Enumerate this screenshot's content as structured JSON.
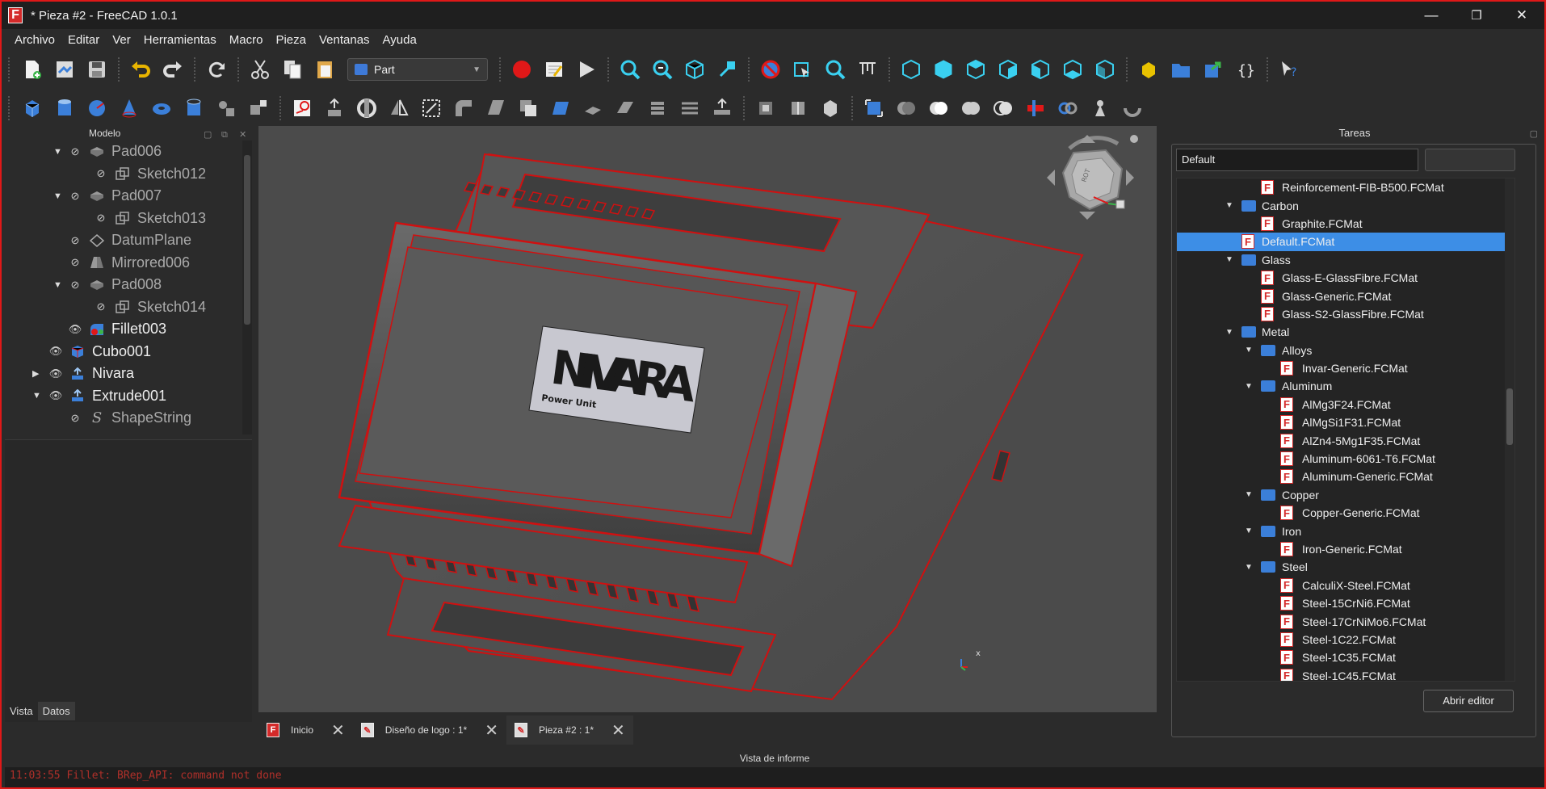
{
  "window": {
    "title": "* Pieza #2 - FreeCAD 1.0.1",
    "logo": "F",
    "controls": {
      "minimize": "—",
      "maximize": "❐",
      "close": "✕"
    }
  },
  "menubar": [
    "Archivo",
    "Editar",
    "Ver",
    "Herramientas",
    "Macro",
    "Pieza",
    "Ventanas",
    "Ayuda"
  ],
  "toolbar": {
    "workbench": "Part"
  },
  "model_panel": {
    "title": "Modelo",
    "items": [
      {
        "label": "Pad006"
      },
      {
        "label": "Sketch012"
      },
      {
        "label": "Pad007"
      },
      {
        "label": "Sketch013"
      },
      {
        "label": "DatumPlane"
      },
      {
        "label": "Mirrored006"
      },
      {
        "label": "Pad008"
      },
      {
        "label": "Sketch014"
      },
      {
        "label": "Fillet003"
      },
      {
        "label": "Cubo001"
      },
      {
        "label": "Nivara"
      },
      {
        "label": "Extrude001"
      },
      {
        "label": "ShapeString"
      }
    ],
    "tabs": [
      "Vista",
      "Datos"
    ]
  },
  "view3d": {
    "logo_text": "NIVARA",
    "logo_subtext": "Power Unit",
    "axis_label": "x"
  },
  "doc_tabs": [
    {
      "label": "Inicio"
    },
    {
      "label": "Diseño de logo : 1*"
    },
    {
      "label": "Pieza #2 : 1*"
    }
  ],
  "tasks_panel": {
    "title": "Tareas",
    "combo_value": "Default",
    "button": "Abrir editor",
    "materials": [
      {
        "label": "Reinforcement-FIB-B500.FCMat"
      },
      {
        "label": "Carbon"
      },
      {
        "label": "Graphite.FCMat"
      },
      {
        "label": "Default.FCMat"
      },
      {
        "label": "Glass"
      },
      {
        "label": "Glass-E-GlassFibre.FCMat"
      },
      {
        "label": "Glass-Generic.FCMat"
      },
      {
        "label": "Glass-S2-GlassFibre.FCMat"
      },
      {
        "label": "Metal"
      },
      {
        "label": "Alloys"
      },
      {
        "label": "Invar-Generic.FCMat"
      },
      {
        "label": "Aluminum"
      },
      {
        "label": "AlMg3F24.FCMat"
      },
      {
        "label": "AlMgSi1F31.FCMat"
      },
      {
        "label": "AlZn4-5Mg1F35.FCMat"
      },
      {
        "label": "Aluminum-6061-T6.FCMat"
      },
      {
        "label": "Aluminum-Generic.FCMat"
      },
      {
        "label": "Copper"
      },
      {
        "label": "Copper-Generic.FCMat"
      },
      {
        "label": "Iron"
      },
      {
        "label": "Iron-Generic.FCMat"
      },
      {
        "label": "Steel"
      },
      {
        "label": "CalculiX-Steel.FCMat"
      },
      {
        "label": "Steel-15CrNi6.FCMat"
      },
      {
        "label": "Steel-17CrNiMo6.FCMat"
      },
      {
        "label": "Steel-1C22.FCMat"
      },
      {
        "label": "Steel-1C35.FCMat"
      },
      {
        "label": "Steel-1C45.FCMat"
      }
    ]
  },
  "report": {
    "title": "Vista de informe",
    "message": "11:03:55  Fillet: BRep_API: command not done"
  },
  "colors": {
    "accent": "#3d8ee6",
    "frame": "#e01818",
    "folder": "#3b7fd9",
    "error": "#b0302a"
  }
}
